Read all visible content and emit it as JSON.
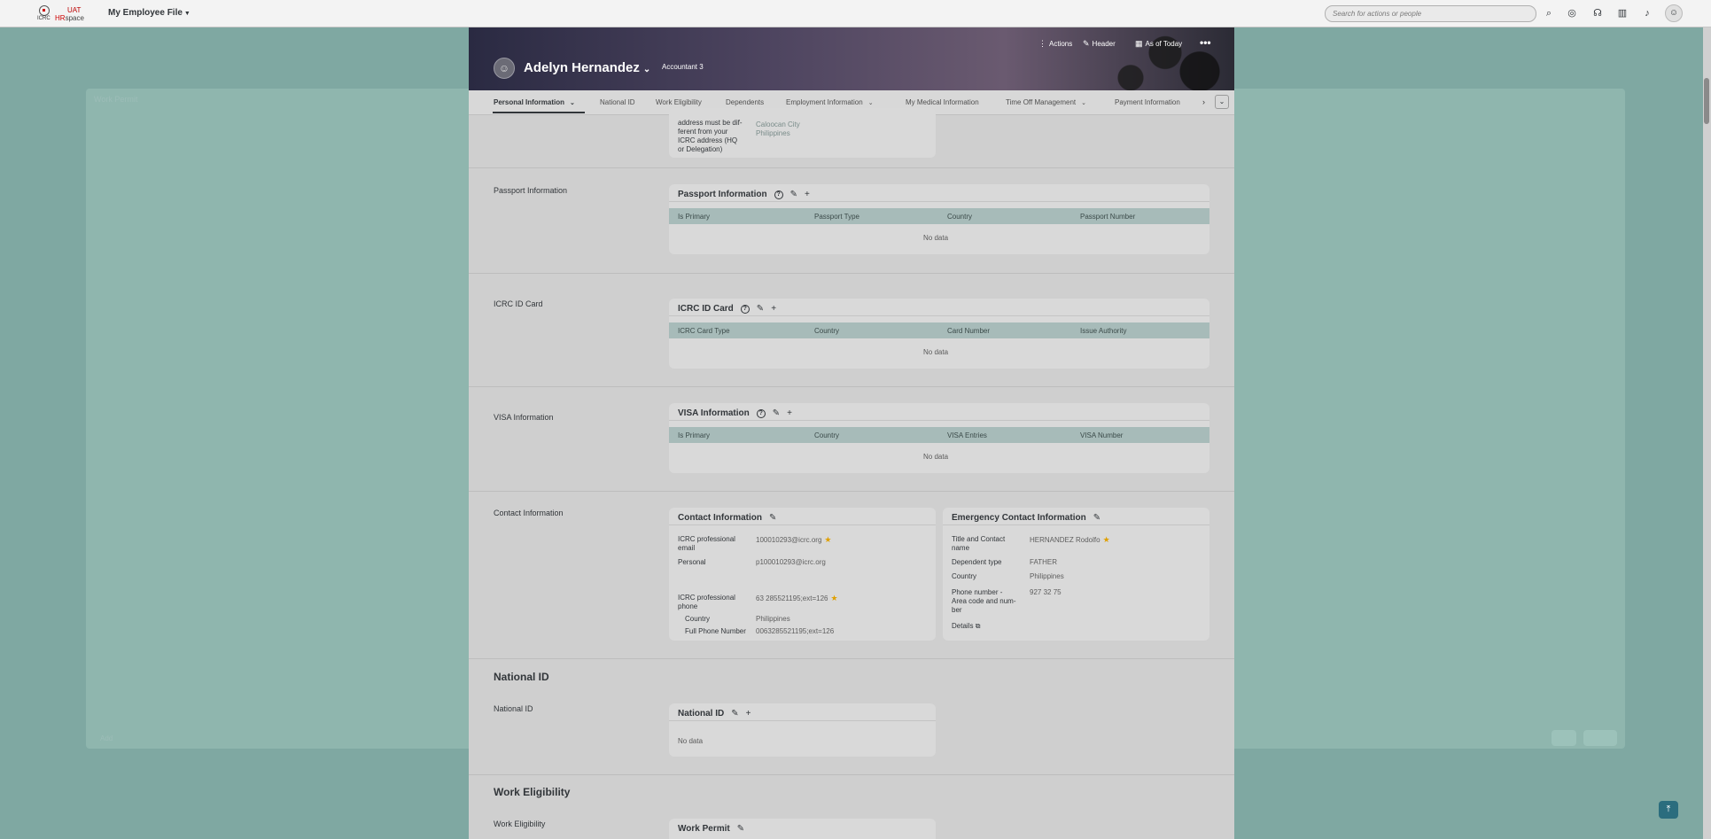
{
  "shell": {
    "logo_org": "ICRC",
    "logo_uat": "UAT",
    "logo_hr": "HR",
    "logo_space": "space",
    "app_title": "My Employee File",
    "search_placeholder": "Search for actions or people"
  },
  "background": {
    "title": "Work Permit",
    "add_label": "Add"
  },
  "header": {
    "employee_name": "Adelyn Hernandez",
    "job_title": "Accountant 3",
    "actions_label": "Actions",
    "header_label": "Header",
    "as_of_label": "As of Today"
  },
  "tabs": [
    {
      "label": "Personal Information",
      "active": true,
      "has_menu": true
    },
    {
      "label": "National ID"
    },
    {
      "label": "Work Eligibility"
    },
    {
      "label": "Dependents"
    },
    {
      "label": "Employment Information",
      "has_menu": true
    },
    {
      "label": "My Medical Information"
    },
    {
      "label": "Time Off Management",
      "has_menu": true
    },
    {
      "label": "Payment Information"
    }
  ],
  "address_snippet": {
    "label_lines": [
      "address must be dif-",
      "ferent from your",
      "ICRC address (HQ",
      "or Delegation)"
    ],
    "value_lines": [
      "Caloocan City",
      "Philippines"
    ]
  },
  "passport": {
    "section_label": "Passport Information",
    "card_title": "Passport Information",
    "columns": [
      "Is Primary",
      "Passport Type",
      "Country",
      "Passport Number"
    ],
    "empty_text": "No data"
  },
  "icrc_id": {
    "section_label": "ICRC ID Card",
    "card_title": "ICRC ID Card",
    "columns": [
      "ICRC Card Type",
      "Country",
      "Card Number",
      "Issue Authority"
    ],
    "empty_text": "No data"
  },
  "visa": {
    "section_label": "VISA Information",
    "card_title": "VISA Information",
    "columns": [
      "Is Primary",
      "Country",
      "VISA Entries",
      "VISA Number"
    ],
    "empty_text": "No data"
  },
  "contact": {
    "section_label": "Contact Information",
    "card_title": "Contact Information",
    "email_label_1": "ICRC professional",
    "email_label_2": "email",
    "email_value": "100010293@icrc.org",
    "personal_label": "Personal",
    "personal_value": "p100010293@icrc.org",
    "phone_label_1": "ICRC professional",
    "phone_label_2": "phone",
    "phone_value": "63 285521195;ext=126",
    "country_label": "Country",
    "country_value": "Philippines",
    "full_phone_label": "Full Phone Number",
    "full_phone_value": "0063285521195;ext=126"
  },
  "emergency": {
    "card_title": "Emergency Contact Information",
    "name_label_1": "Title and Contact",
    "name_label_2": "name",
    "name_value": "HERNANDEZ Rodolfo",
    "dep_type_label": "Dependent type",
    "dep_type_value": "FATHER",
    "country_label": "Country",
    "country_value": "Philippines",
    "phone_label_1": "Phone number -",
    "phone_label_2": "Area code and num-",
    "phone_label_3": "ber",
    "phone_value": "927 32 75",
    "details_label": "Details"
  },
  "national_id": {
    "heading": "National ID",
    "section_label": "National ID",
    "card_title": "National ID",
    "empty_text": "No data"
  },
  "work_eligibility": {
    "heading": "Work Eligibility",
    "section_label": "Work Eligibility",
    "card_title": "Work Permit"
  }
}
